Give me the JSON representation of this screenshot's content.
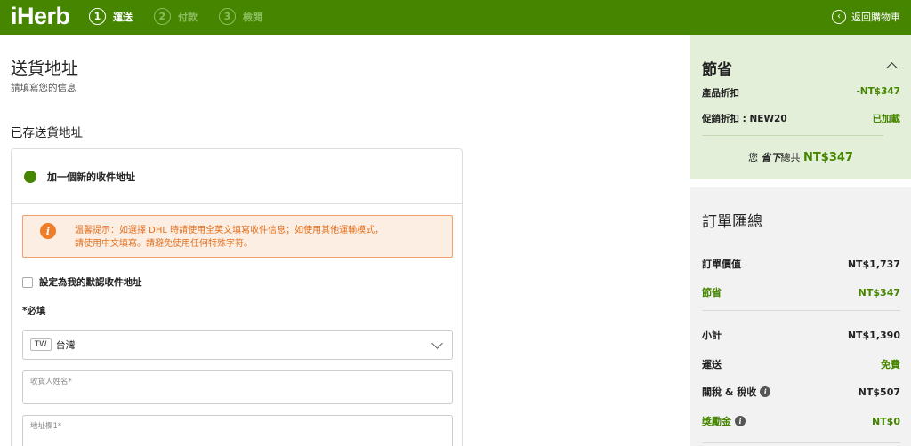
{
  "header": {
    "logo": "iHerb",
    "steps": [
      {
        "num": "1",
        "label": "運送"
      },
      {
        "num": "2",
        "label": "付款"
      },
      {
        "num": "3",
        "label": "檢閱"
      }
    ],
    "back_label": "返回購物車"
  },
  "main": {
    "title": "送貨地址",
    "subtitle": "請填寫您的信息",
    "saved_title": "已存送貨地址",
    "add_address_label": "加一個新的收件地址",
    "notice_line1": "溫馨提示：如選擇 DHL 時請使用全英文填寫收件信息；如使用其他運輸模式，",
    "notice_line2": "請使用中文填寫。請避免使用任何特殊字符。",
    "default_checkbox_label": "設定為我的默認收件地址",
    "required_label": "*必填",
    "country_code": "TW",
    "country_name": "台灣",
    "recipient_placeholder": "收貨人姓名*",
    "address1_placeholder": "地址欄1*"
  },
  "savings": {
    "title": "節省",
    "product_discount_label": "產品折扣",
    "product_discount_value": "-NT$347",
    "promo_label": "促銷折扣 : NEW20",
    "promo_value": "已加載",
    "total_prefix": "您",
    "total_bold": "省下",
    "total_suffix": "總共",
    "total_amount": "NT$347"
  },
  "summary": {
    "title": "訂單匯總",
    "order_value_label": "訂單價值",
    "order_value": "NT$1,737",
    "savings_label": "節省",
    "savings_value": "NT$347",
    "subtotal_label": "小計",
    "subtotal_value": "NT$1,390",
    "shipping_label": "運送",
    "shipping_value": "免費",
    "tax_label": "關稅 & 稅收",
    "tax_value": "NT$507",
    "rewards_label": "獎勵金",
    "rewards_value": "NT$0"
  },
  "colors": {
    "brand_green": "#458500",
    "savings_bg": "#e3efd9",
    "notice_orange": "#e2701f"
  }
}
